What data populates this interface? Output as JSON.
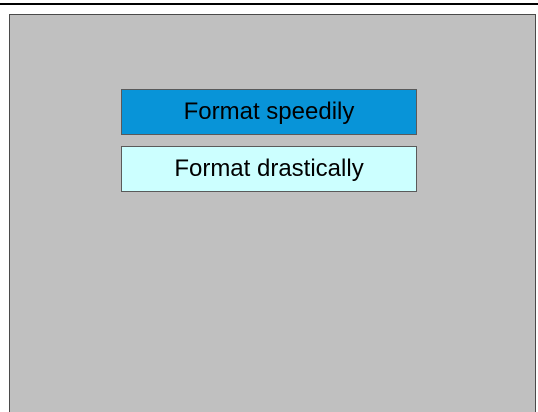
{
  "menu": {
    "options": [
      {
        "label": "Format speedily",
        "selected": true
      },
      {
        "label": "Format drastically",
        "selected": false
      }
    ]
  },
  "colors": {
    "panel_background": "#c0c0c0",
    "selected_option_background": "#0894d8",
    "option_background": "#ccffff",
    "text": "#000000"
  }
}
